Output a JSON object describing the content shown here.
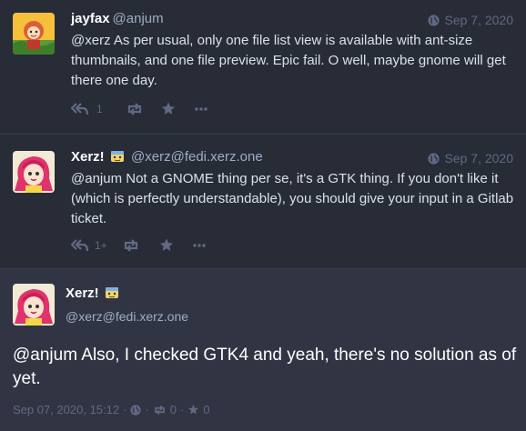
{
  "statuses": [
    {
      "display_name": "jayfax",
      "acct": "@anjum",
      "time": "Sep 7, 2020",
      "text": "@xerz As per usual, only one file list view is available with ant-size thumbnails, and one file preview. Epic fail. O well, maybe gnome will get there one day.",
      "reply_count": "1",
      "avatar_icon": "sunflower-avatar"
    },
    {
      "display_name": "Xerz!",
      "acct": "@xerz@fedi.xerz.one",
      "time": "Sep 7, 2020",
      "text": "@anjum Not a GNOME thing per se, it's a GTK thing. If you don't like it (which is perfectly understandable), you should give your input in a Gitlab ticket.",
      "reply_count": "1+",
      "avatar_icon": "pink-hair-avatar"
    }
  ],
  "focal": {
    "display_name": "Xerz!",
    "acct": "@xerz@fedi.xerz.one",
    "text": "@anjum Also, I checked GTK4 and yeah, there's no solution as of yet.",
    "date": "Sep 07, 2020, 15:12",
    "separator": "·",
    "boost_count": "0",
    "fav_count": "0"
  },
  "colors": {
    "background": "#282c37",
    "focal_background": "#313543",
    "muted": "#606984",
    "account": "#9baec8"
  }
}
